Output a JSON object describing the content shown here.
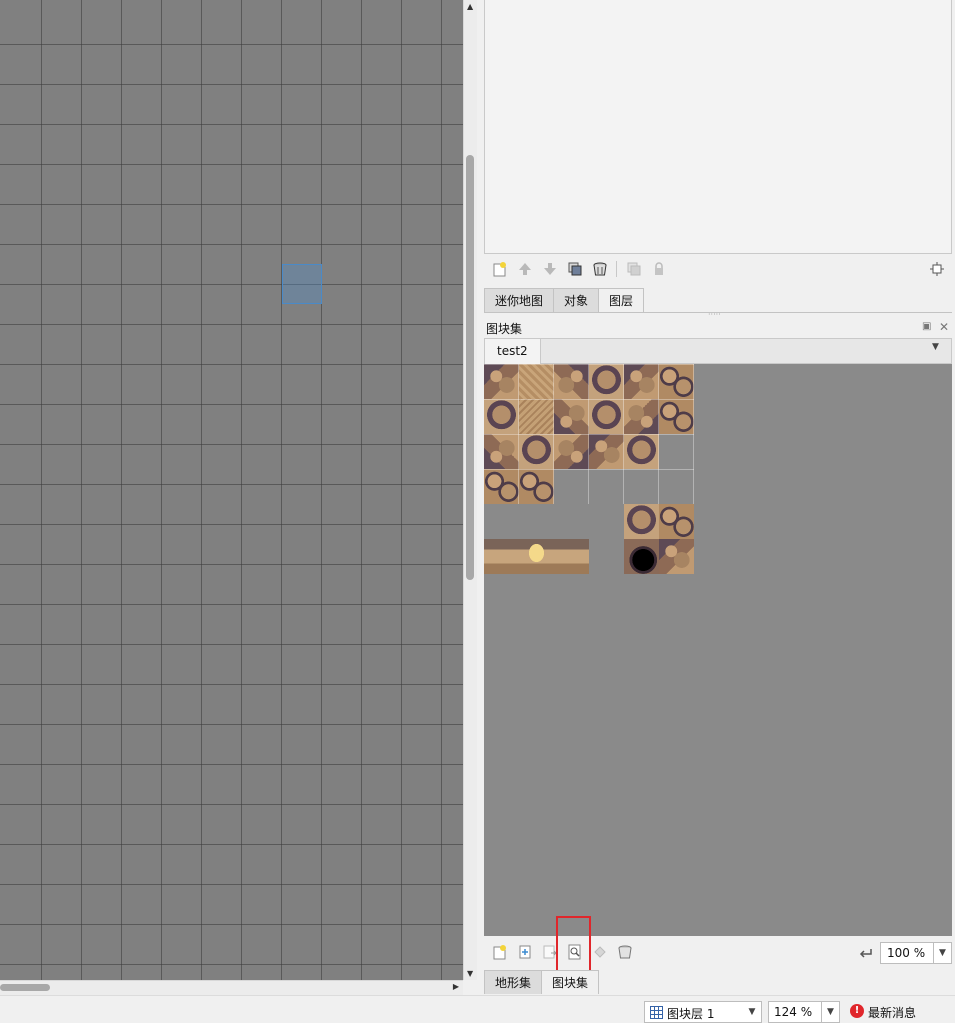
{
  "layers_panel": {
    "tabs": [
      {
        "label": "迷你地图"
      },
      {
        "label": "对象"
      },
      {
        "label": "图层"
      }
    ],
    "active_tab": "图层"
  },
  "tileset_panel": {
    "title": "图块集",
    "tileset_tab": "test2",
    "bottom_tabs": [
      {
        "label": "地形集"
      },
      {
        "label": "图块集"
      }
    ],
    "zoom": "100 %"
  },
  "statusbar": {
    "layer_select": "图块层 1",
    "zoom": "124 %",
    "news_label": "最新消息"
  },
  "colors": {
    "canvas_bg": "#808080",
    "tileset_bg": "#8a8a8a",
    "highlight": "#e0262b",
    "error_badge": "#e0262b"
  },
  "icons": {
    "layer_toolbar": [
      "new-layer-icon",
      "raise-layer-icon",
      "lower-layer-icon",
      "duplicate-layer-icon",
      "delete-layer-icon",
      "toggle-other-layers-icon",
      "lock-layer-icon",
      "layer-properties-icon"
    ],
    "tileset_toolbar": [
      "new-tileset-icon",
      "embed-tileset-icon",
      "export-tileset-icon",
      "edit-tileset-icon",
      "dynamic-wrapping-icon",
      "remove-tileset-icon",
      "undo-icon"
    ]
  }
}
